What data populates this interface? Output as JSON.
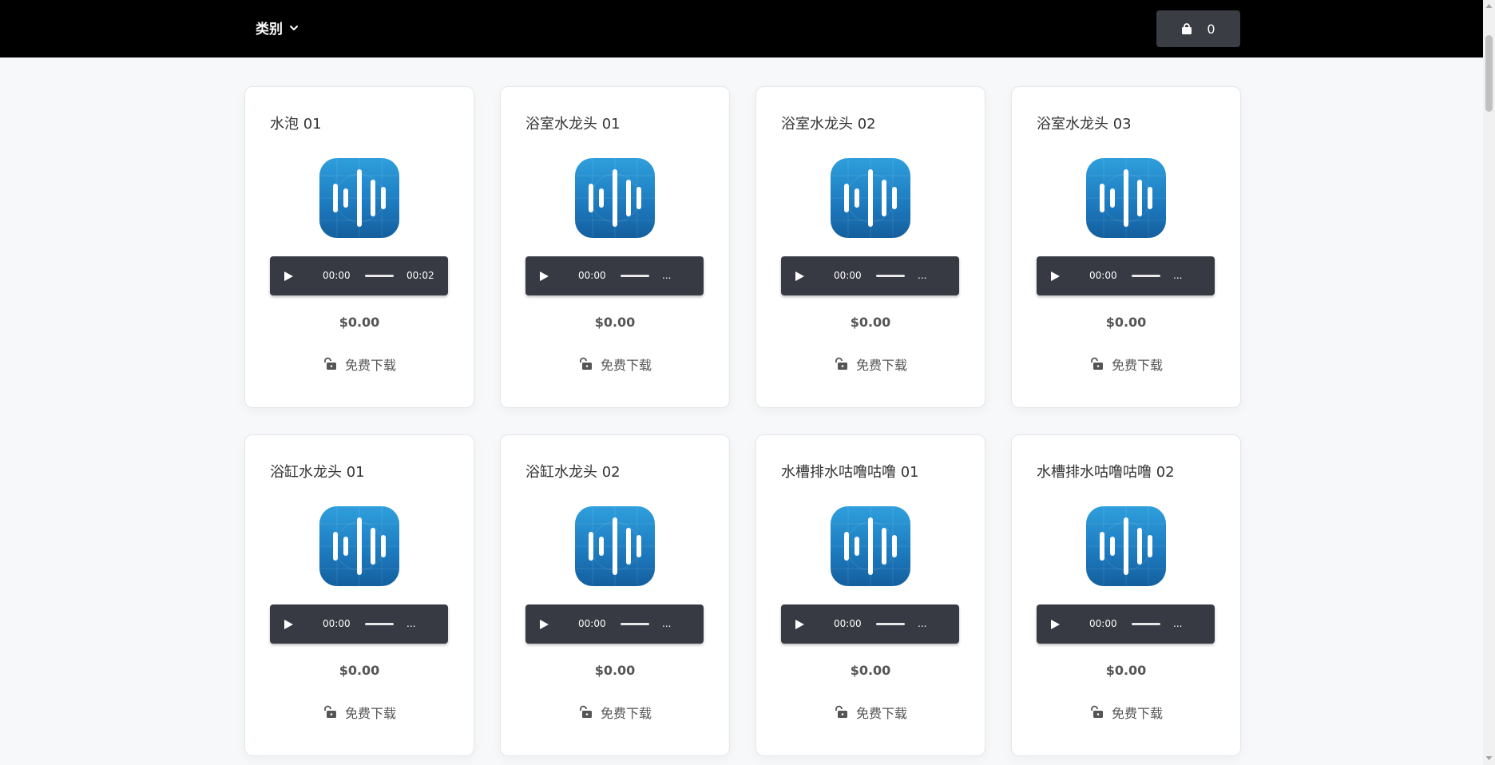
{
  "header": {
    "category_label": "类别",
    "cart_count": "0"
  },
  "icons": {
    "category_dropdown": "chevron-down-icon",
    "cart": "shopping-bag-icon",
    "play": "play-icon",
    "download": "unlock-icon",
    "product": "sound-wave-icon"
  },
  "colors": {
    "header_bg": "#000000",
    "player_bg": "#373a42",
    "icon_gradient_top": "#2f9fdc",
    "icon_gradient_bottom": "#145f9e"
  },
  "products": [
    {
      "title": "水泡 01",
      "time_current": "00:00",
      "time_duration": "00:02",
      "price": "$0.00",
      "download_label": "免费下载"
    },
    {
      "title": "浴室水龙头 01",
      "time_current": "00:00",
      "time_duration": "...",
      "price": "$0.00",
      "download_label": "免费下载"
    },
    {
      "title": "浴室水龙头 02",
      "time_current": "00:00",
      "time_duration": "...",
      "price": "$0.00",
      "download_label": "免费下载"
    },
    {
      "title": "浴室水龙头 03",
      "time_current": "00:00",
      "time_duration": "...",
      "price": "$0.00",
      "download_label": "免费下载"
    },
    {
      "title": "浴缸水龙头 01",
      "time_current": "00:00",
      "time_duration": "...",
      "price": "$0.00",
      "download_label": "免费下载"
    },
    {
      "title": "浴缸水龙头 02",
      "time_current": "00:00",
      "time_duration": "...",
      "price": "$0.00",
      "download_label": "免费下载"
    },
    {
      "title": "水槽排水咕噜咕噜 01",
      "time_current": "00:00",
      "time_duration": "...",
      "price": "$0.00",
      "download_label": "免费下载"
    },
    {
      "title": "水槽排水咕噜咕噜 02",
      "time_current": "00:00",
      "time_duration": "...",
      "price": "$0.00",
      "download_label": "免费下载"
    }
  ]
}
